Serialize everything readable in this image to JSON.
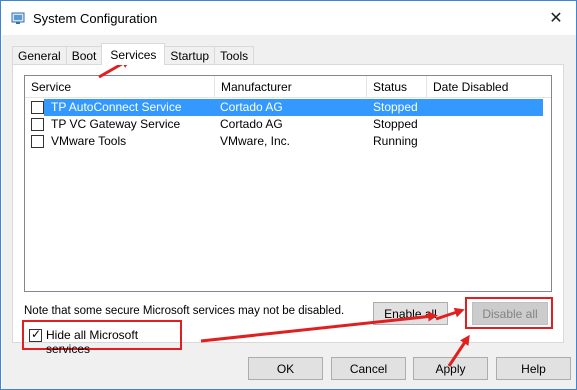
{
  "window": {
    "title": "System Configuration",
    "close_glyph": "✕"
  },
  "tabs": [
    {
      "label": "General"
    },
    {
      "label": "Boot"
    },
    {
      "label": "Services",
      "active": true
    },
    {
      "label": "Startup"
    },
    {
      "label": "Tools"
    }
  ],
  "services": {
    "columns": [
      "Service",
      "Manufacturer",
      "Status",
      "Date Disabled"
    ],
    "rows": [
      {
        "service": "TP AutoConnect Service",
        "manufacturer": "Cortado AG",
        "status": "Stopped",
        "date_disabled": "",
        "checked": false,
        "selected": true
      },
      {
        "service": "TP VC Gateway Service",
        "manufacturer": "Cortado AG",
        "status": "Stopped",
        "date_disabled": "",
        "checked": false,
        "selected": false
      },
      {
        "service": "VMware Tools",
        "manufacturer": "VMware, Inc.",
        "status": "Running",
        "date_disabled": "",
        "checked": false,
        "selected": false
      }
    ],
    "note": "Note that some secure Microsoft services may not be disabled.",
    "hide_ms_label": "Hide all Microsoft services",
    "hide_ms_checked": true,
    "enable_all_label": "Enable all",
    "disable_all_label": "Disable all"
  },
  "footer": {
    "ok_label": "OK",
    "cancel_label": "Cancel",
    "apply_label": "Apply",
    "help_label": "Help"
  },
  "colors": {
    "selection": "#3399ff",
    "annotation": "#e02020",
    "window_border": "#3e86d1"
  },
  "icons": {
    "app": "system-config-icon",
    "close": "close-icon"
  }
}
